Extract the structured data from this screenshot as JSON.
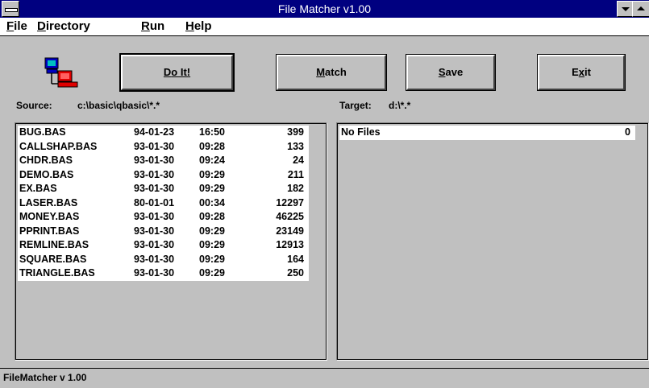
{
  "window": {
    "title": "File Matcher v1.00"
  },
  "menu": [
    {
      "pre": "",
      "key": "F",
      "post": "ile"
    },
    {
      "pre": "",
      "key": "D",
      "post": "irectory"
    },
    {
      "pre": "",
      "key": "R",
      "post": "un"
    },
    {
      "pre": "",
      "key": "H",
      "post": "elp"
    }
  ],
  "buttons": {
    "doit": {
      "pre": "",
      "key": "D",
      "post": "o It!"
    },
    "match": {
      "pre": "",
      "key": "M",
      "post": "atch"
    },
    "save": {
      "pre": "",
      "key": "S",
      "post": "ave"
    },
    "exit": {
      "pre": "E",
      "key": "x",
      "post": "it"
    }
  },
  "source": {
    "label": "Source:",
    "value": "c:\\basic\\qbasic\\*.*"
  },
  "target": {
    "label": "Target:",
    "value": "d:\\*.*"
  },
  "left_list": [
    {
      "name": "BUG.BAS",
      "date": "94-01-23",
      "time": "16:50",
      "size": "399"
    },
    {
      "name": "CALLSHAP.BAS",
      "date": "93-01-30",
      "time": "09:28",
      "size": "133"
    },
    {
      "name": "CHDR.BAS",
      "date": "93-01-30",
      "time": "09:24",
      "size": "24"
    },
    {
      "name": "DEMO.BAS",
      "date": "93-01-30",
      "time": "09:29",
      "size": "211"
    },
    {
      "name": "EX.BAS",
      "date": "93-01-30",
      "time": "09:29",
      "size": "182"
    },
    {
      "name": "LASER.BAS",
      "date": "80-01-01",
      "time": "00:34",
      "size": "12297"
    },
    {
      "name": "MONEY.BAS",
      "date": "93-01-30",
      "time": "09:28",
      "size": "46225"
    },
    {
      "name": "PPRINT.BAS",
      "date": "93-01-30",
      "time": "09:29",
      "size": "23149"
    },
    {
      "name": "REMLINE.BAS",
      "date": "93-01-30",
      "time": "09:29",
      "size": "12913"
    },
    {
      "name": "SQUARE.BAS",
      "date": "93-01-30",
      "time": "09:29",
      "size": "164"
    },
    {
      "name": "TRIANGLE.BAS",
      "date": "93-01-30",
      "time": "09:29",
      "size": "250"
    }
  ],
  "right_list": [
    {
      "name": "No Files",
      "size": "0"
    }
  ],
  "status": "FileMatcher v 1.00",
  "colors": {
    "titlebar": "#000080",
    "face": "#c0c0c0",
    "list_bg": "#ffffff"
  },
  "icons": {
    "sysmenu": "system-menu-icon",
    "minimize": "minimize-icon",
    "maximize": "maximize-icon",
    "app": "networked-computers-icon"
  }
}
